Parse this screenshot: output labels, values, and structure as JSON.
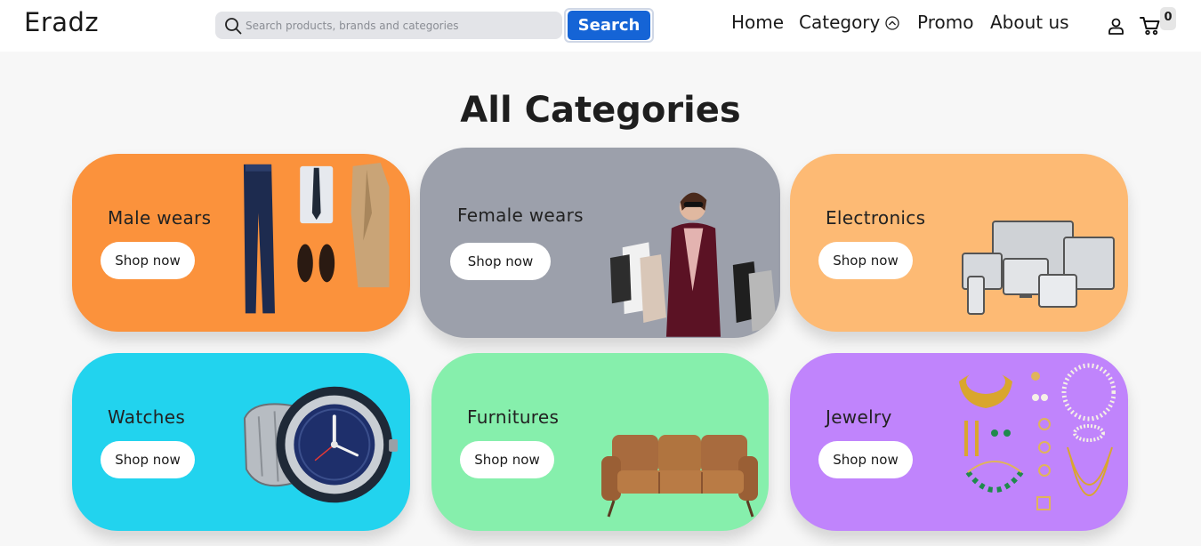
{
  "header": {
    "brand": "Eradz",
    "search": {
      "placeholder": "Search products, brands and categories",
      "button_label": "Search"
    },
    "nav": {
      "home": "Home",
      "category": "Category",
      "promo": "Promo",
      "about": "About us"
    },
    "cart_count": "0"
  },
  "main": {
    "title": "All Categories",
    "categories": [
      {
        "label": "Male wears",
        "button": "Shop now",
        "color": "#fb923c"
      },
      {
        "label": "Female wears",
        "button": "Shop now",
        "color": "#9ca0ab"
      },
      {
        "label": "Electronics",
        "button": "Shop now",
        "color": "#fdba74"
      },
      {
        "label": "Watches",
        "button": "Shop now",
        "color": "#22d3ee"
      },
      {
        "label": "Furnitures",
        "button": "Shop now",
        "color": "#86efac"
      },
      {
        "label": "Jewelry",
        "button": "Shop now",
        "color": "#c084fc"
      }
    ]
  },
  "icons": [
    "search-icon",
    "chevron-circle-icon",
    "user-icon",
    "cart-icon"
  ]
}
